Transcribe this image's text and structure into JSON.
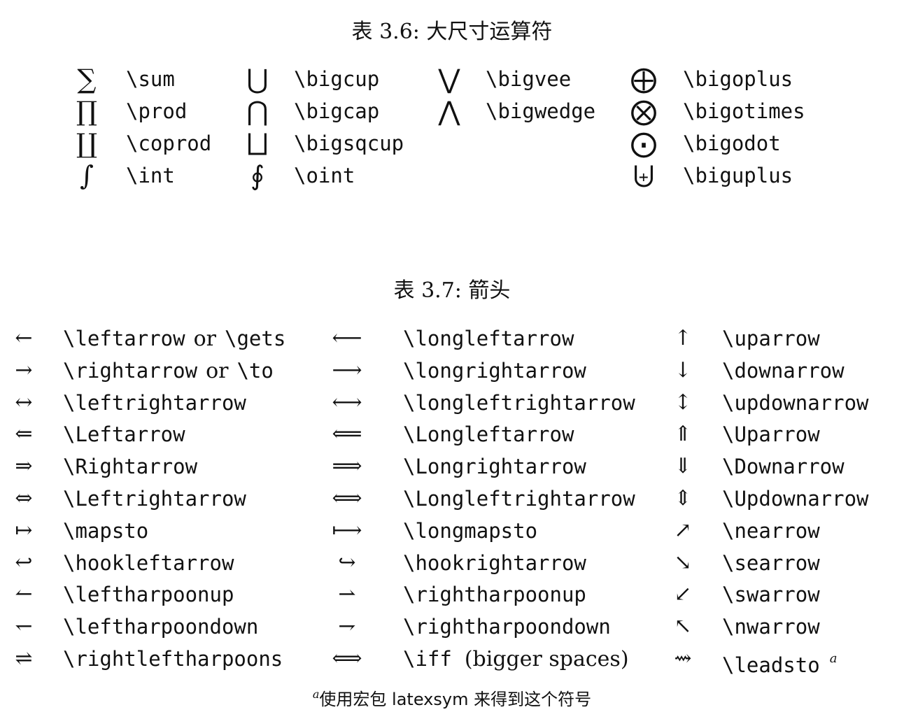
{
  "table_big_ops": {
    "caption": "表 3.6: 大尺寸运算符",
    "rows": [
      [
        {
          "s": "∑",
          "c": "\\sum"
        },
        {
          "s": "⋃",
          "c": "\\bigcup"
        },
        {
          "s": "⋁",
          "c": "\\bigvee"
        },
        {
          "s": "⨁",
          "c": "\\bigoplus"
        }
      ],
      [
        {
          "s": "∏",
          "c": "\\prod"
        },
        {
          "s": "⋂",
          "c": "\\bigcap"
        },
        {
          "s": "⋀",
          "c": "\\bigwedge"
        },
        {
          "s": "⨂",
          "c": "\\bigotimes"
        }
      ],
      [
        {
          "s": "∐",
          "c": "\\coprod"
        },
        {
          "s": "⨆",
          "c": "\\bigsqcup"
        },
        {
          "s": "",
          "c": ""
        },
        {
          "s": "⨀",
          "c": "\\bigodot"
        }
      ],
      [
        {
          "s": "∫",
          "c": "\\int"
        },
        {
          "s": "∮",
          "c": "\\oint"
        },
        {
          "s": "",
          "c": ""
        },
        {
          "s": "⨄",
          "c": "\\biguplus"
        }
      ]
    ]
  },
  "table_arrows": {
    "caption": "表 3.7: 箭头",
    "rows": [
      [
        {
          "s": "←",
          "c": "\\leftarrow",
          "or": "or",
          "c2": "\\gets"
        },
        {
          "s": "⟵",
          "c": "\\longleftarrow"
        },
        {
          "s": "↑",
          "c": "\\uparrow"
        }
      ],
      [
        {
          "s": "→",
          "c": "\\rightarrow",
          "or": "or",
          "c2": "\\to"
        },
        {
          "s": "⟶",
          "c": "\\longrightarrow"
        },
        {
          "s": "↓",
          "c": "\\downarrow"
        }
      ],
      [
        {
          "s": "↔",
          "c": "\\leftrightarrow"
        },
        {
          "s": "⟷",
          "c": "\\longleftrightarrow"
        },
        {
          "s": "↕",
          "c": "\\updownarrow"
        }
      ],
      [
        {
          "s": "⇐",
          "c": "\\Leftarrow"
        },
        {
          "s": "⟸",
          "c": "\\Longleftarrow"
        },
        {
          "s": "⇑",
          "c": "\\Uparrow"
        }
      ],
      [
        {
          "s": "⇒",
          "c": "\\Rightarrow"
        },
        {
          "s": "⟹",
          "c": "\\Longrightarrow"
        },
        {
          "s": "⇓",
          "c": "\\Downarrow"
        }
      ],
      [
        {
          "s": "⇔",
          "c": "\\Leftrightarrow"
        },
        {
          "s": "⟺",
          "c": "\\Longleftrightarrow"
        },
        {
          "s": "⇕",
          "c": "\\Updownarrow"
        }
      ],
      [
        {
          "s": "↦",
          "c": "\\mapsto"
        },
        {
          "s": "⟼",
          "c": "\\longmapsto"
        },
        {
          "s": "↗",
          "c": "\\nearrow"
        }
      ],
      [
        {
          "s": "↩",
          "c": "\\hookleftarrow"
        },
        {
          "s": "↪",
          "c": "\\hookrightarrow"
        },
        {
          "s": "↘",
          "c": "\\searrow"
        }
      ],
      [
        {
          "s": "↼",
          "c": "\\leftharpoonup"
        },
        {
          "s": "⇀",
          "c": "\\rightharpoonup"
        },
        {
          "s": "↙",
          "c": "\\swarrow"
        }
      ],
      [
        {
          "s": "↽",
          "c": "\\leftharpoondown"
        },
        {
          "s": "⇁",
          "c": "\\rightharpoondown"
        },
        {
          "s": "↖",
          "c": "\\nwarrow"
        }
      ],
      [
        {
          "s": "⇌",
          "c": "\\rightleftharpoons"
        },
        {
          "s": "⟺",
          "c": "\\iff",
          "note": "(bigger spaces)"
        },
        {
          "s": "⇝",
          "c": "\\leadsto",
          "sup": "a"
        }
      ]
    ]
  },
  "footnote": {
    "marker": "a",
    "text": "使用宏包 latexsym 来得到这个符号"
  }
}
